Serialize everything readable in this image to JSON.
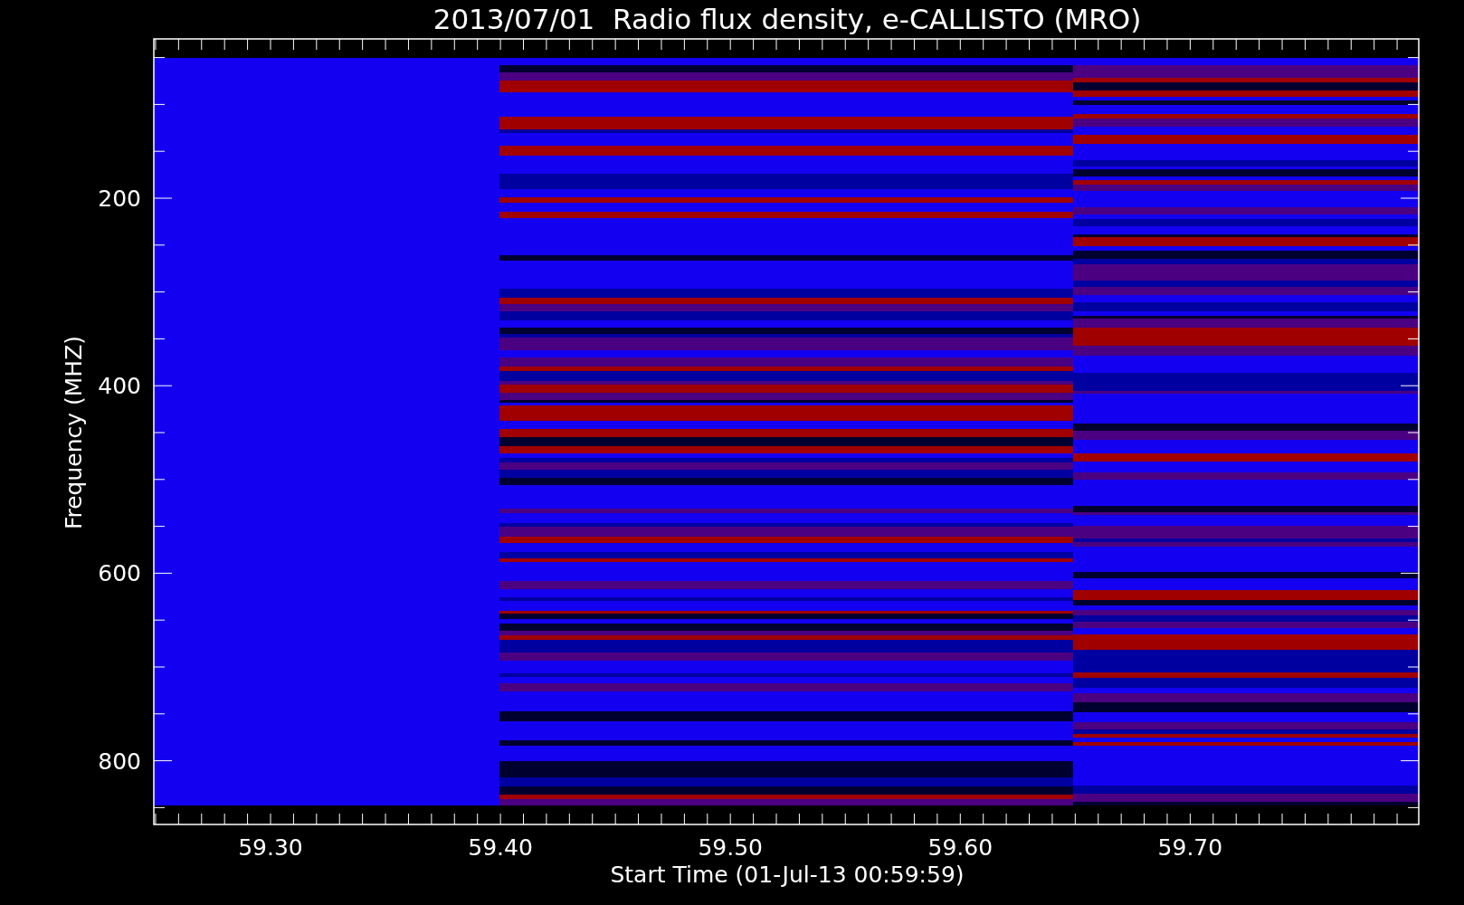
{
  "title": "2013/07/01  Radio flux density, e-CALLISTO (MRO)",
  "y_axis": {
    "label": "Frequency (MHZ)",
    "ticks": [
      "200",
      "400",
      "600",
      "800"
    ]
  },
  "x_axis": {
    "label": "Start Time (01-Jul-13 00:59:59)",
    "ticks": [
      "59.30",
      "59.40",
      "59.50",
      "59.60",
      "59.70"
    ]
  }
}
